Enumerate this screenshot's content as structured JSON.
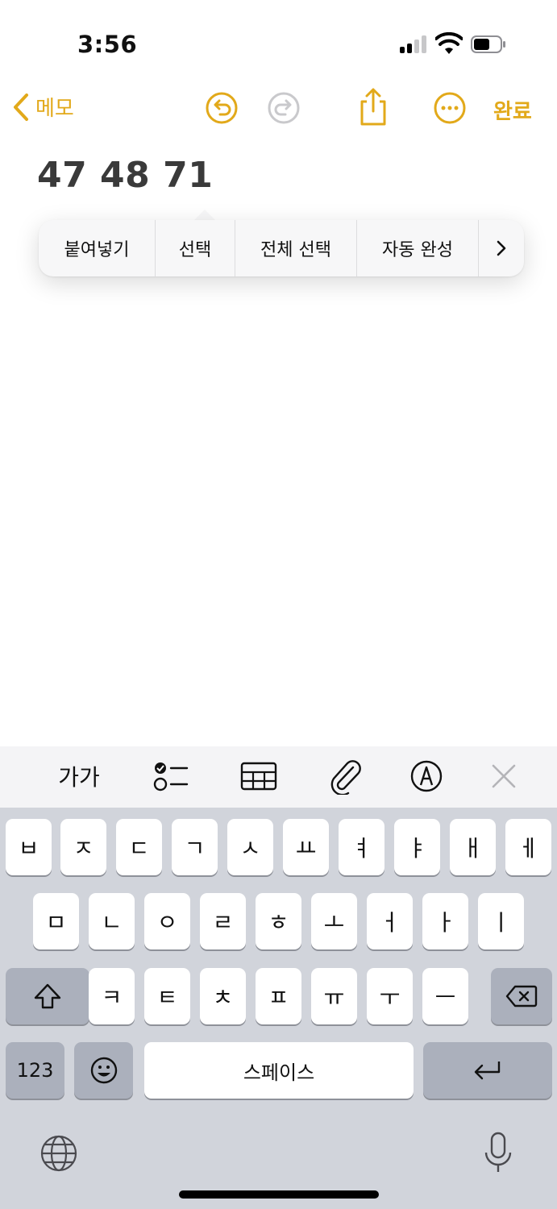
{
  "status_bar": {
    "time": "3:56"
  },
  "nav": {
    "back_label": "메모",
    "done_label": "완료"
  },
  "note": {
    "text": "47 48 71"
  },
  "context_menu": {
    "items": [
      "붙여넣기",
      "선택",
      "전체 선택",
      "자동 완성"
    ],
    "more_glyph": "›"
  },
  "toolbar": {
    "text_format_label": "가가"
  },
  "keyboard": {
    "row1": [
      "ㅂ",
      "ㅈ",
      "ㄷ",
      "ㄱ",
      "ㅅ",
      "ㅛ",
      "ㅕ",
      "ㅑ",
      "ㅐ",
      "ㅔ"
    ],
    "row2": [
      "ㅁ",
      "ㄴ",
      "ㅇ",
      "ㄹ",
      "ㅎ",
      "ㅗ",
      "ㅓ",
      "ㅏ",
      "ㅣ"
    ],
    "row3": [
      "ㅋ",
      "ㅌ",
      "ㅊ",
      "ㅍ",
      "ㅠ",
      "ㅜ",
      "ㅡ"
    ],
    "numbers_label": "123",
    "space_label": "스페이스"
  },
  "colors": {
    "accent": "#E2A91A",
    "keyboard_bg": "#D1D4DB",
    "key_dark": "#ABB0BC"
  }
}
